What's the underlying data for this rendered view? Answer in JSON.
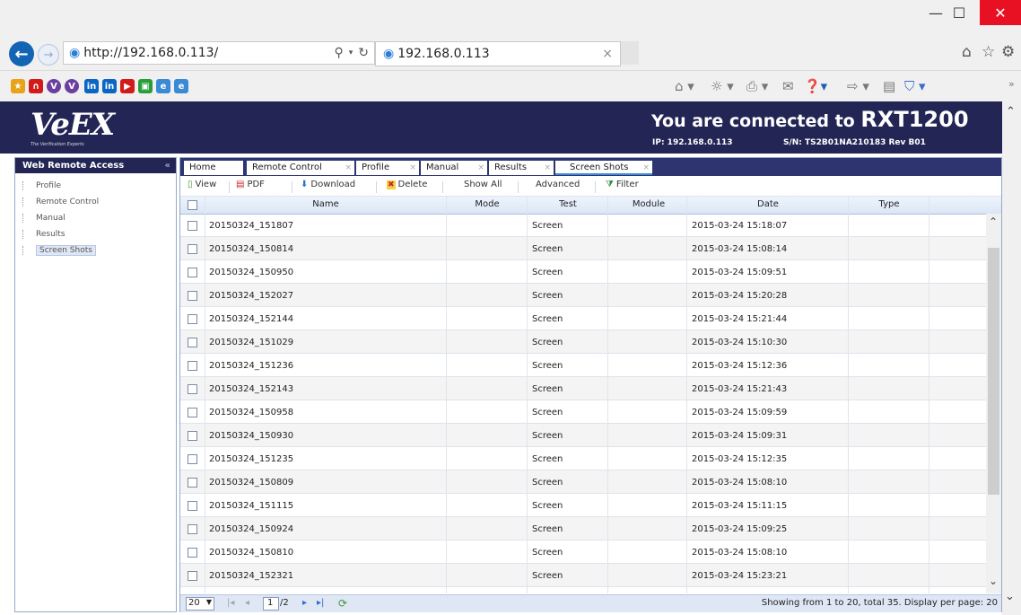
{
  "window": {
    "minimize": "—",
    "maximize": "☐",
    "close": "✕"
  },
  "browser": {
    "url": "http://192.168.0.113/",
    "search_icon": "⚲",
    "tab_title": "192.168.0.113",
    "tab_close": "×"
  },
  "header": {
    "connected_prefix": "You are connected to",
    "device": "RXT1200",
    "ip": "IP: 192.168.0.113",
    "serial": "S/N: TS2B01NA210183 Rev B01"
  },
  "logo": {
    "text": "VeEX",
    "tagline": "The Verification Experts"
  },
  "sidebar": {
    "title": "Web Remote Access",
    "items": [
      "Profile",
      "Remote Control",
      "Manual",
      "Results",
      "Screen Shots"
    ]
  },
  "tabs": [
    "Home",
    "Remote Control",
    "Profile",
    "Manual",
    "Results",
    "Screen Shots"
  ],
  "toolbar": {
    "view": "View",
    "pdf": "PDF",
    "download": "Download",
    "delete": "Delete",
    "show_all": "Show All",
    "advanced": "Advanced",
    "filter": "Filter"
  },
  "table": {
    "columns": [
      "Name",
      "Mode",
      "Test",
      "Module",
      "Date",
      "Type"
    ],
    "rows": [
      [
        "20150324_151807",
        "",
        "Screen",
        "",
        "2015-03-24 15:18:07",
        ""
      ],
      [
        "20150324_150814",
        "",
        "Screen",
        "",
        "2015-03-24 15:08:14",
        ""
      ],
      [
        "20150324_150950",
        "",
        "Screen",
        "",
        "2015-03-24 15:09:51",
        ""
      ],
      [
        "20150324_152027",
        "",
        "Screen",
        "",
        "2015-03-24 15:20:28",
        ""
      ],
      [
        "20150324_152144",
        "",
        "Screen",
        "",
        "2015-03-24 15:21:44",
        ""
      ],
      [
        "20150324_151029",
        "",
        "Screen",
        "",
        "2015-03-24 15:10:30",
        ""
      ],
      [
        "20150324_151236",
        "",
        "Screen",
        "",
        "2015-03-24 15:12:36",
        ""
      ],
      [
        "20150324_152143",
        "",
        "Screen",
        "",
        "2015-03-24 15:21:43",
        ""
      ],
      [
        "20150324_150958",
        "",
        "Screen",
        "",
        "2015-03-24 15:09:59",
        ""
      ],
      [
        "20150324_150930",
        "",
        "Screen",
        "",
        "2015-03-24 15:09:31",
        ""
      ],
      [
        "20150324_151235",
        "",
        "Screen",
        "",
        "2015-03-24 15:12:35",
        ""
      ],
      [
        "20150324_150809",
        "",
        "Screen",
        "",
        "2015-03-24 15:08:10",
        ""
      ],
      [
        "20150324_151115",
        "",
        "Screen",
        "",
        "2015-03-24 15:11:15",
        ""
      ],
      [
        "20150324_150924",
        "",
        "Screen",
        "",
        "2015-03-24 15:09:25",
        ""
      ],
      [
        "20150324_150810",
        "",
        "Screen",
        "",
        "2015-03-24 15:08:10",
        ""
      ],
      [
        "20150324_152321",
        "",
        "Screen",
        "",
        "2015-03-24 15:23:21",
        ""
      ]
    ]
  },
  "pager": {
    "per_page": "20",
    "page_input": "1",
    "total_pages": "/2",
    "summary": "Showing from 1 to 20, total 35. Display per page: 20"
  },
  "colors": {
    "header_bg": "#232655",
    "tab_strip": "#2d3470",
    "close_red": "#e81123"
  }
}
